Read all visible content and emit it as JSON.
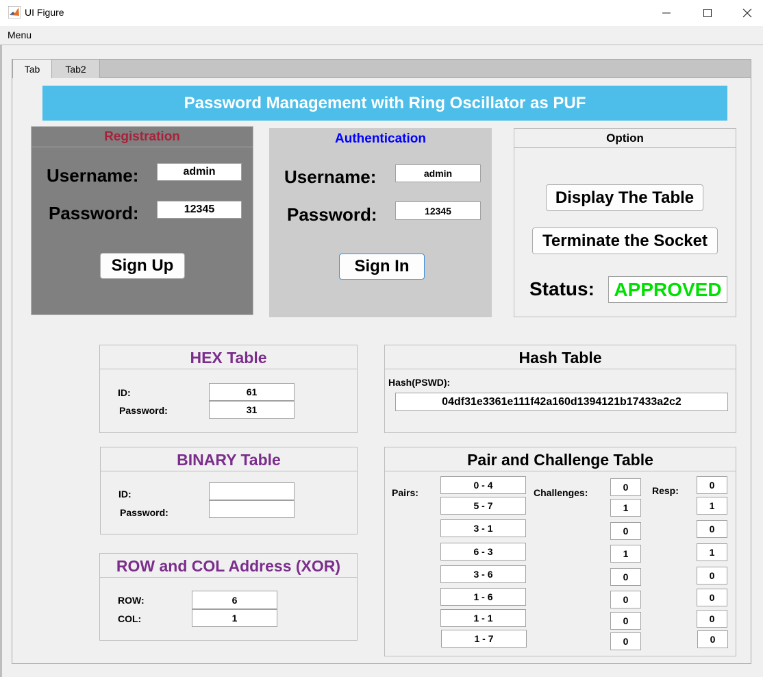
{
  "window": {
    "title": "UI Figure",
    "minimize": "—",
    "maximize": "☐",
    "close": "✕"
  },
  "menu": {
    "label": "Menu"
  },
  "tabs": [
    {
      "label": "Tab"
    },
    {
      "label": "Tab2"
    }
  ],
  "banner": {
    "title": "Password Management with Ring Oscillator as PUF"
  },
  "registration": {
    "title": "Registration",
    "username_label": "Username:",
    "username_value": "admin",
    "password_label": "Password:",
    "password_value": "12345",
    "button": "Sign Up"
  },
  "authentication": {
    "title": "Authentication",
    "username_label": "Username:",
    "username_value": "admin",
    "password_label": "Password:",
    "password_value": "12345",
    "button": "Sign In"
  },
  "option": {
    "title": "Option",
    "display_button": "Display The Table",
    "terminate_button": "Terminate the Socket",
    "status_label": "Status:",
    "status_value": "APPROVED"
  },
  "hex_table": {
    "title": "HEX Table",
    "id_label": "ID:",
    "id_value": "61",
    "password_label": "Password:",
    "password_value": "31"
  },
  "hash_table": {
    "title": "Hash Table",
    "label": "Hash(PSWD):",
    "value": "04df31e3361e111f42a160d1394121b17433a2c2"
  },
  "binary_table": {
    "title": "BINARY Table",
    "id_label": "ID:",
    "id_value": "",
    "password_label": "Password:",
    "password_value": ""
  },
  "rowcol": {
    "title": "ROW and COL Address (XOR)",
    "row_label": "ROW:",
    "row_value": "6",
    "col_label": "COL:",
    "col_value": "1"
  },
  "pair_table": {
    "title": "Pair and Challenge Table",
    "pairs_label": "Pairs:",
    "challenges_label": "Challenges:",
    "resp_label": "Resp:",
    "pairs": [
      "0 - 4",
      "5 - 7",
      "3 - 1",
      "6 - 3",
      "3 - 6",
      "1 - 6",
      "1 - 1",
      "1 - 7"
    ],
    "challenges": [
      "0",
      "1",
      "0",
      "1",
      "0",
      "0",
      "0",
      "0"
    ],
    "resp": [
      "0",
      "1",
      "0",
      "1",
      "0",
      "0",
      "0",
      "0"
    ]
  },
  "colors": {
    "banner": "#4dbde9",
    "registration_title": "#a8213a",
    "authentication_title": "#0000ff",
    "table_title": "#7b2d8b",
    "status": "#00e000",
    "registration_bg": "#808080",
    "authentication_bg": "#cccccc"
  }
}
